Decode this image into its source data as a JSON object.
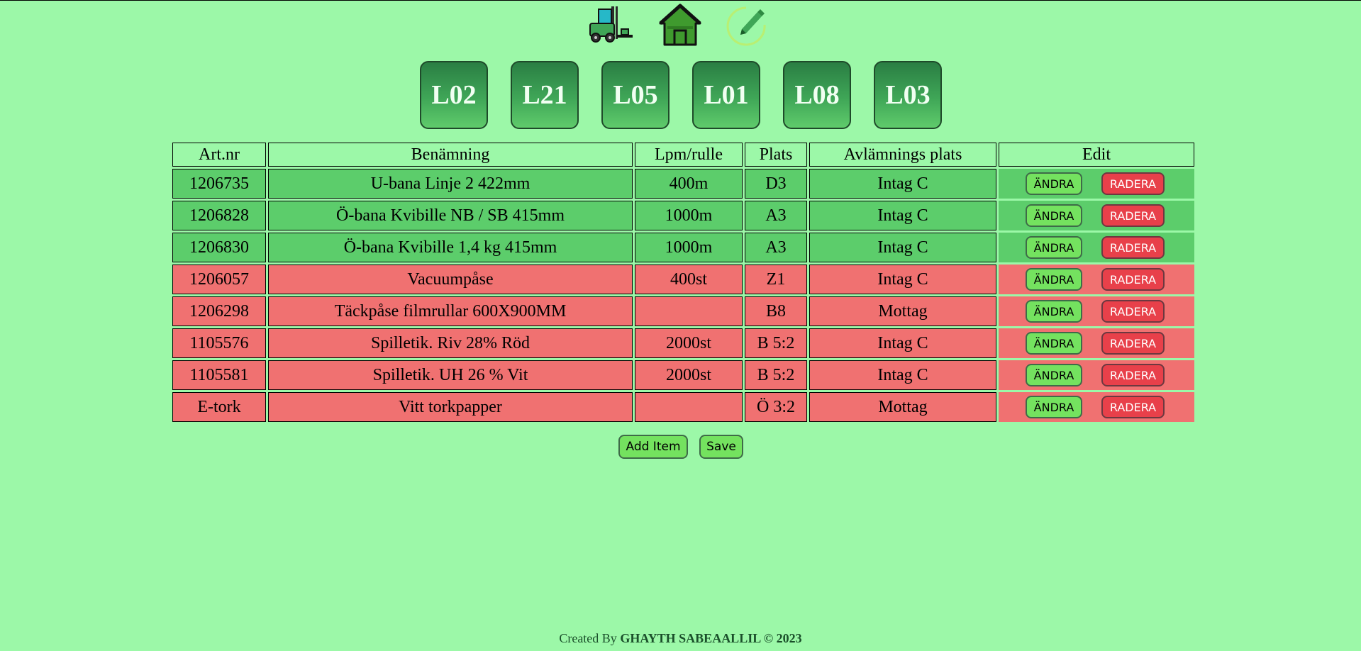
{
  "nav_icons": [
    {
      "name": "forklift-icon"
    },
    {
      "name": "home-icon"
    },
    {
      "name": "pencil-edit-icon"
    }
  ],
  "line_buttons": [
    "L02",
    "L21",
    "L05",
    "L01",
    "L08",
    "L03"
  ],
  "table": {
    "headers": [
      "Art.nr",
      "Benämning",
      "Lpm/rulle",
      "Plats",
      "Avlämnings plats",
      "Edit"
    ],
    "rows": [
      {
        "art": "1206735",
        "ben": "U-bana Linje 2 422mm",
        "lpm": "400m",
        "plats": "D3",
        "avl": "Intag C",
        "status": "green"
      },
      {
        "art": "1206828",
        "ben": "Ö-bana Kvibille NB / SB 415mm",
        "lpm": "1000m",
        "plats": "A3",
        "avl": "Intag C",
        "status": "green"
      },
      {
        "art": "1206830",
        "ben": "Ö-bana Kvibille 1,4 kg 415mm",
        "lpm": "1000m",
        "plats": "A3",
        "avl": "Intag C",
        "status": "green"
      },
      {
        "art": "1206057",
        "ben": "Vacuumpåse",
        "lpm": "400st",
        "plats": "Z1",
        "avl": "Intag C",
        "status": "red"
      },
      {
        "art": "1206298",
        "ben": "Täckpåse filmrullar 600X900MM",
        "lpm": "",
        "plats": "B8",
        "avl": "Mottag",
        "status": "red"
      },
      {
        "art": "1105576",
        "ben": "Spilletik. Riv 28% Röd",
        "lpm": "2000st",
        "plats": "B 5:2",
        "avl": "Intag C",
        "status": "red"
      },
      {
        "art": "1105581",
        "ben": "Spilletik. UH 26 % Vit",
        "lpm": "2000st",
        "plats": "B 5:2",
        "avl": "Intag C",
        "status": "red"
      },
      {
        "art": "E-tork",
        "ben": "Vitt torkpapper",
        "lpm": "",
        "plats": "Ö 3:2",
        "avl": "Mottag",
        "status": "red"
      }
    ],
    "edit_label": "ÄNDRA",
    "delete_label": "RADERA"
  },
  "actions": {
    "add_label": "Add Item",
    "save_label": "Save"
  },
  "footer": {
    "prefix": "Created By ",
    "author": "GHAYTH SABEAALLIL © 2023"
  },
  "colors": {
    "background": "#9cf8a8",
    "row_green": "#5ccd6b",
    "row_red": "#f07171",
    "edit_button": "#74e25f",
    "delete_button": "#e8404a",
    "line_button": "#3fa657"
  }
}
